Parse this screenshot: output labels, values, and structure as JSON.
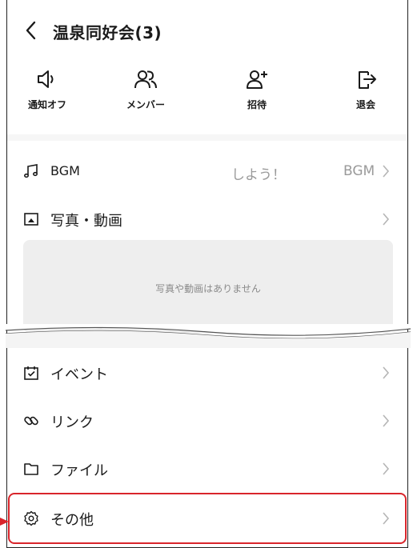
{
  "header": {
    "title": "温泉同好会(3)"
  },
  "actions": [
    {
      "label": "通知オフ",
      "icon": "speaker-muted-icon"
    },
    {
      "label": "メンバー",
      "icon": "members-icon"
    },
    {
      "label": "招待",
      "icon": "invite-user-icon"
    },
    {
      "label": "退会",
      "icon": "leave-icon"
    }
  ],
  "bgm": {
    "label": "BGM",
    "value_text": "しよう！",
    "value_suffix": "BGM"
  },
  "media": {
    "label": "写真・動画",
    "empty_text": "写真や動画はありません"
  },
  "rows": [
    {
      "label": "イベント",
      "icon": "calendar-check-icon"
    },
    {
      "label": "リンク",
      "icon": "link-icon"
    },
    {
      "label": "ファイル",
      "icon": "folder-icon"
    },
    {
      "label": "その他",
      "icon": "gear-icon"
    }
  ],
  "colors": {
    "highlight": "#d9252b",
    "muted_text": "#9a9a9a",
    "placeholder_bg": "#eeeeee"
  }
}
